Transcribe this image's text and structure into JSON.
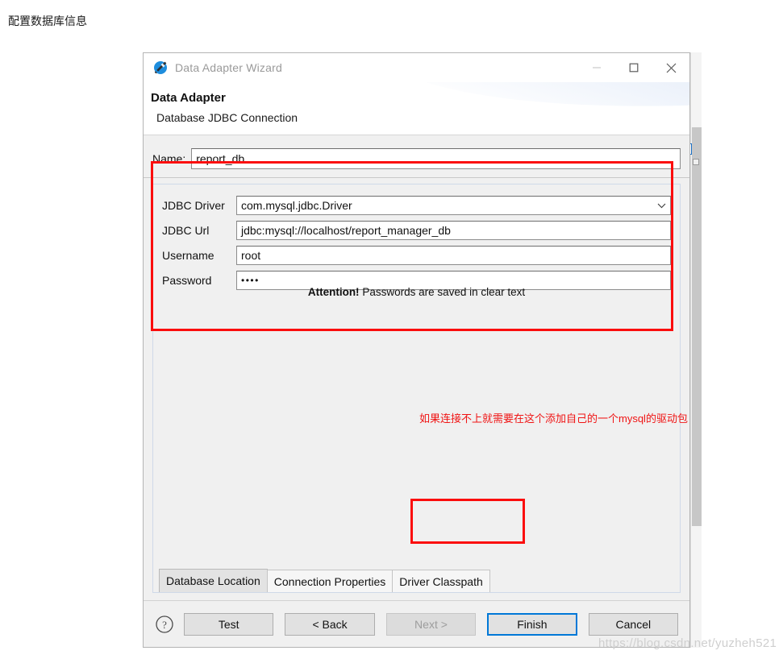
{
  "page": {
    "caption": "配置数据库信息",
    "watermark": "https://blog.csdn.net/yuzheh521"
  },
  "dialog": {
    "titlebar": {
      "icon": "jasper-wizard-icon",
      "title": "Data Adapter Wizard",
      "minimize_label": "—",
      "maximize_label": "□",
      "close_label": "✕"
    },
    "header": {
      "title": "Data Adapter",
      "subtitle": "Database JDBC Connection"
    },
    "name_field": {
      "label": "Name:",
      "value": "report_db"
    },
    "fields": [
      {
        "label": "JDBC Driver",
        "value": "com.mysql.jdbc.Driver",
        "type": "combo"
      },
      {
        "label": "JDBC Url",
        "value": "jdbc:mysql://localhost/report_manager_db",
        "type": "text"
      },
      {
        "label": "Username",
        "value": "root",
        "type": "text"
      },
      {
        "label": "Password",
        "value": "••••",
        "type": "password"
      }
    ],
    "attention": {
      "bold": "Attention!",
      "text": " Passwords are saved in clear text"
    },
    "tabs": [
      {
        "label": "Database Location",
        "selected": true
      },
      {
        "label": "Connection Properties",
        "selected": false
      },
      {
        "label": "Driver Classpath",
        "selected": false
      }
    ],
    "buttons": [
      {
        "label": "Test",
        "state": "enabled"
      },
      {
        "label": "< Back",
        "state": "enabled"
      },
      {
        "label": "Next >",
        "state": "disabled"
      },
      {
        "label": "Finish",
        "state": "default"
      },
      {
        "label": "Cancel",
        "state": "enabled"
      }
    ],
    "help_icon": "question-mark-icon"
  },
  "annotations": {
    "red_note": "如果连接不上就需要在这个添加自己的一个mysql的驱动包",
    "red_color": "#fb0d0d"
  }
}
